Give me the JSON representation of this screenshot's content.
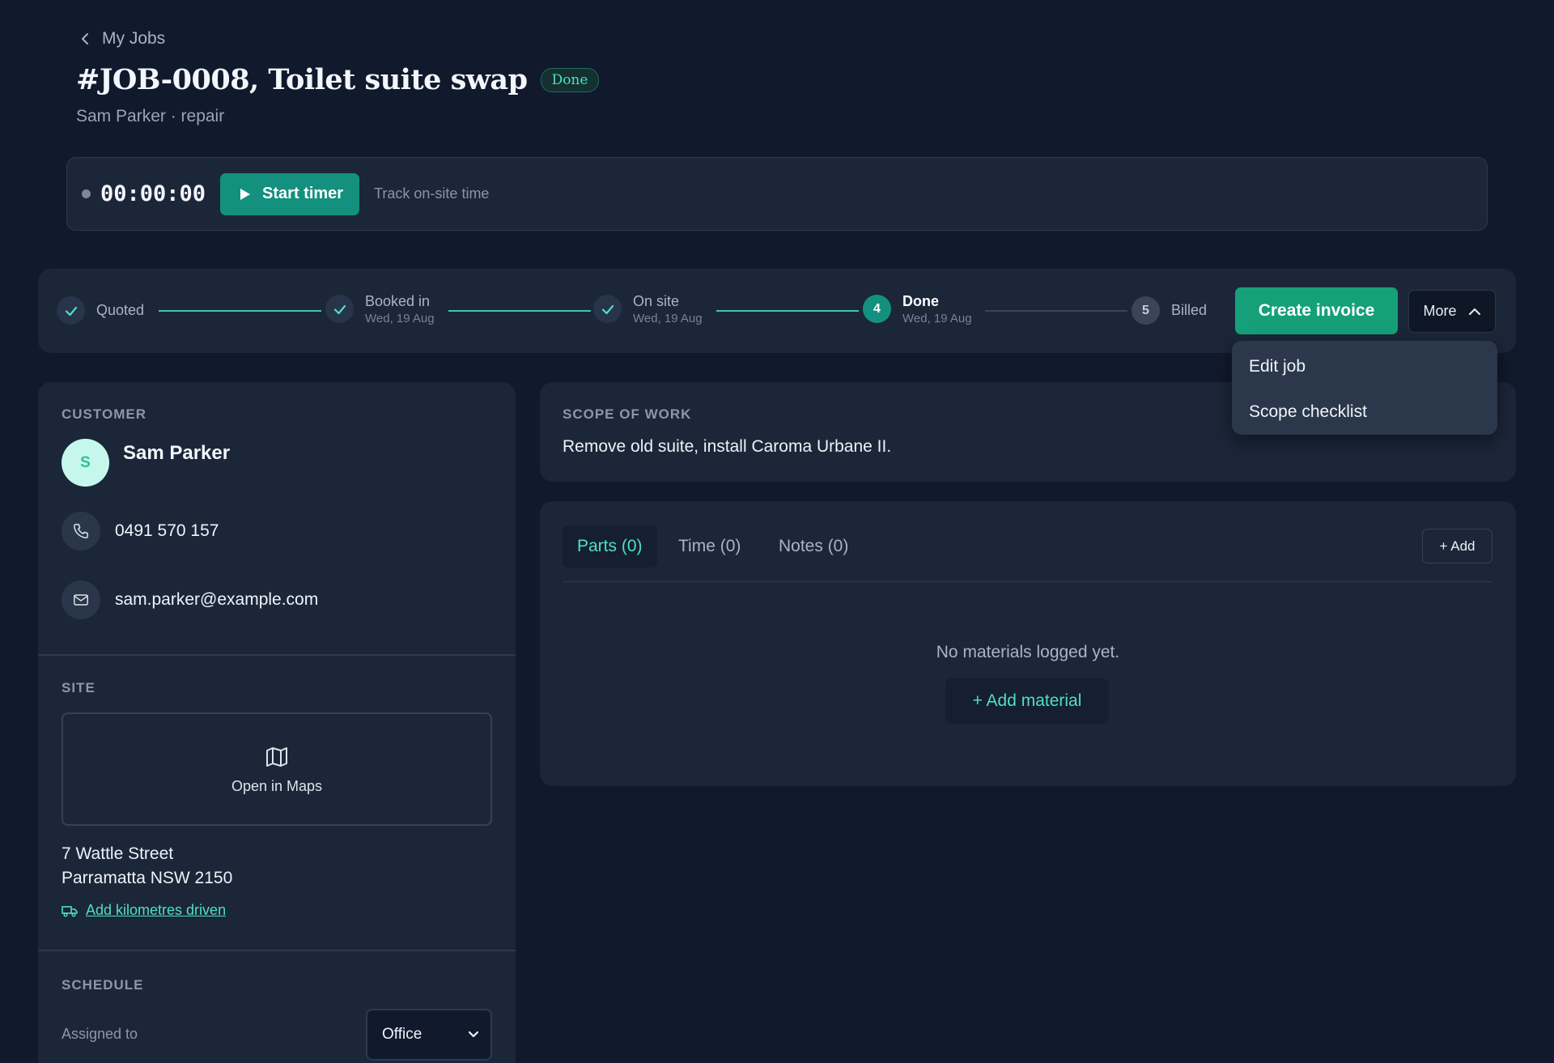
{
  "header": {
    "back_label": "My Jobs",
    "title": "#JOB-0008, Toilet suite swap",
    "status_badge": "Done",
    "subtitle": "Sam Parker · repair"
  },
  "timer": {
    "time": "00:00:00",
    "start_label": "Start timer",
    "hint": "Track on-site time"
  },
  "progress": {
    "steps": [
      {
        "label": "Quoted",
        "date": "",
        "state": "complete"
      },
      {
        "label": "Booked in",
        "date": "Wed, 19 Aug",
        "state": "complete"
      },
      {
        "label": "On site",
        "date": "Wed, 19 Aug",
        "state": "complete"
      },
      {
        "label": "Done",
        "date": "Wed, 19 Aug",
        "state": "current",
        "number": "4"
      },
      {
        "label": "Billed",
        "date": "",
        "state": "pending",
        "number": "5"
      }
    ],
    "create_invoice_label": "Create invoice",
    "more_label": "More"
  },
  "more_menu": {
    "items": [
      "Edit job",
      "Scope checklist"
    ]
  },
  "customer": {
    "section_title": "CUSTOMER",
    "avatar_initial": "S",
    "name": "Sam Parker",
    "phone": "0491 570 157",
    "email": "sam.parker@example.com"
  },
  "site": {
    "section_title": "SITE",
    "maps_label": "Open in Maps",
    "address_line1": "7 Wattle Street",
    "address_line2": "Parramatta NSW 2150",
    "km_link": "Add kilometres driven"
  },
  "schedule": {
    "section_title": "SCHEDULE",
    "assigned_label": "Assigned to",
    "assigned_value": "Office"
  },
  "scope": {
    "section_title": "SCOPE OF WORK",
    "text": "Remove old suite, install Caroma Urbane II."
  },
  "materials": {
    "tabs": [
      "Parts (0)",
      "Time (0)",
      "Notes (0)"
    ],
    "add_label": "+ Add",
    "empty_text": "No materials logged yet.",
    "add_material_label": "+ Add material"
  },
  "colors": {
    "background": "#111a2c",
    "card": "#1b2639",
    "accent": "#4fe0bf",
    "primary_button": "#15a07a",
    "timer_button": "#14907f"
  }
}
